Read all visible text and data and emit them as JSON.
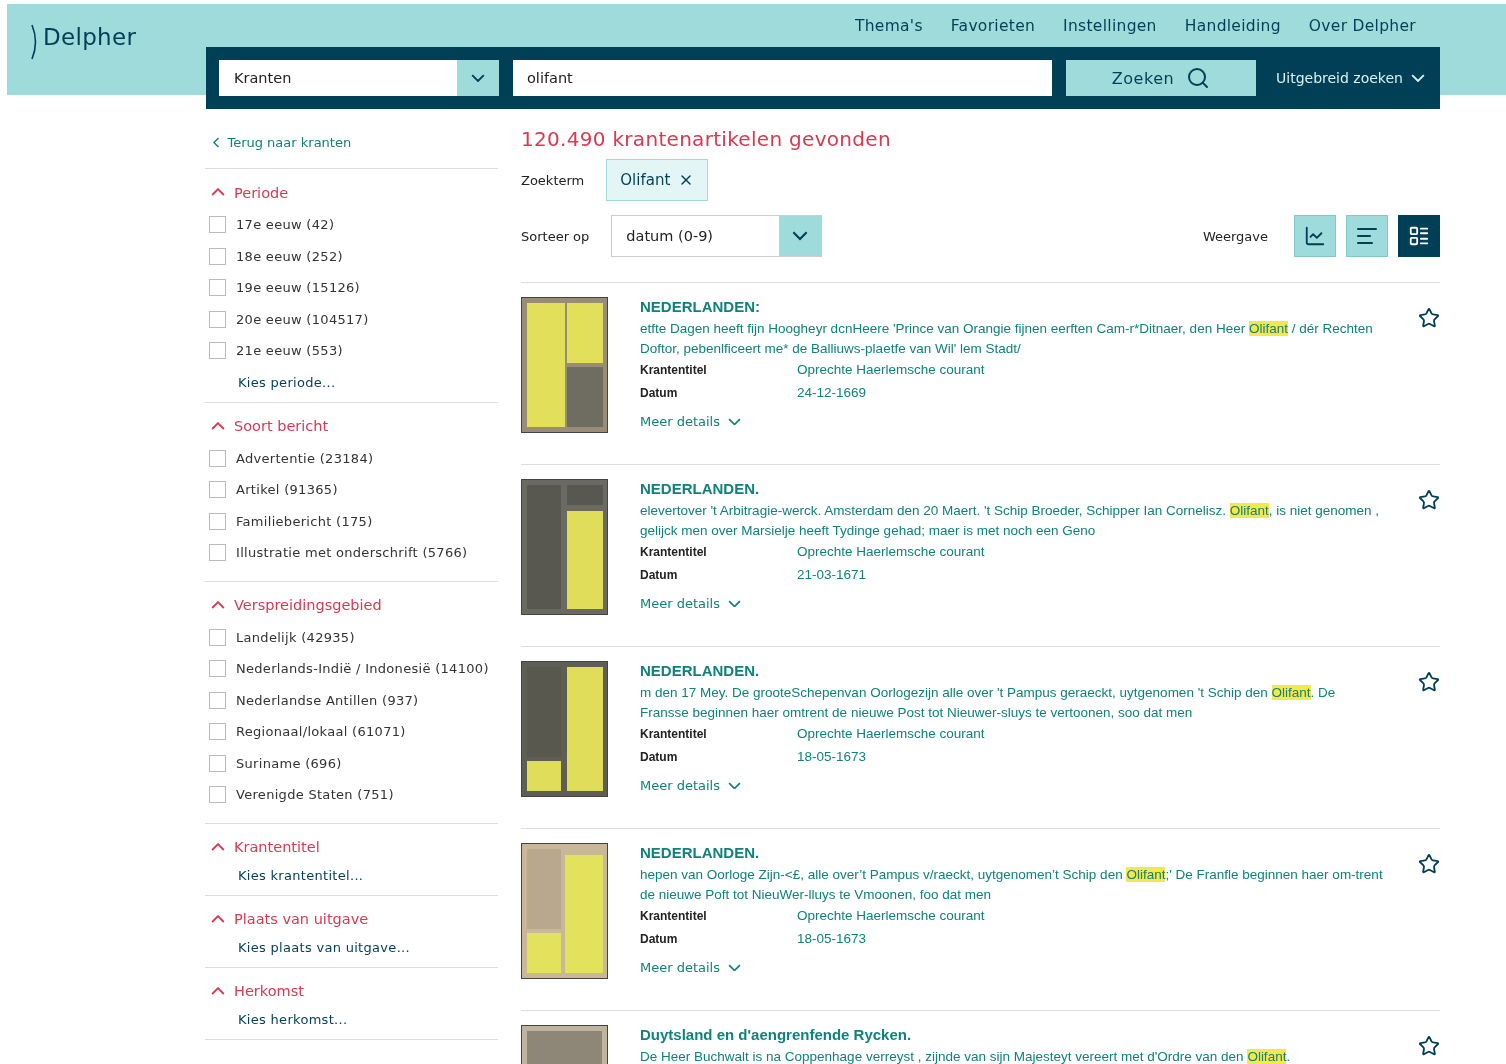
{
  "logo": {
    "text": "Delpher"
  },
  "nav": [
    "Thema's",
    "Favorieten",
    "Instellingen",
    "Handleiding",
    "Over Delpher"
  ],
  "search": {
    "collection": "Kranten",
    "query": "olifant",
    "button": "Zoeken",
    "advanced": "Uitgebreid zoeken"
  },
  "sidebar": {
    "back": "Terug naar kranten",
    "sections": [
      {
        "title": "Periode",
        "expanded": true,
        "items": [
          {
            "label": "17e eeuw (42)",
            "checked": false
          },
          {
            "label": "18e eeuw (252)",
            "checked": false
          },
          {
            "label": "19e eeuw (15126)",
            "checked": false
          },
          {
            "label": "20e eeuw (104517)",
            "checked": false
          },
          {
            "label": "21e eeuw (553)",
            "checked": false
          }
        ],
        "link": "Kies periode..."
      },
      {
        "title": "Soort bericht",
        "expanded": true,
        "items": [
          {
            "label": "Advertentie (23184)",
            "checked": false
          },
          {
            "label": "Artikel (91365)",
            "checked": false
          },
          {
            "label": "Familiebericht (175)",
            "checked": false
          },
          {
            "label": "Illustratie met onderschrift (5766)",
            "checked": false
          }
        ]
      },
      {
        "title": "Verspreidingsgebied",
        "expanded": true,
        "items": [
          {
            "label": "Landelijk (42935)",
            "checked": false
          },
          {
            "label": "Nederlands-Indië / Indonesië (14100)",
            "checked": false
          },
          {
            "label": "Nederlandse Antillen (937)",
            "checked": false
          },
          {
            "label": "Regionaal/lokaal (61071)",
            "checked": false
          },
          {
            "label": "Suriname (696)",
            "checked": false
          },
          {
            "label": "Verenigde Staten (751)",
            "checked": false
          }
        ]
      },
      {
        "title": "Krantentitel",
        "expanded": true,
        "link": "Kies krantentitel..."
      },
      {
        "title": "Plaats van uitgave",
        "expanded": true,
        "link": "Kies plaats van uitgave..."
      },
      {
        "title": "Herkomst",
        "expanded": true,
        "link": "Kies herkomst..."
      }
    ]
  },
  "results_count": "120.490 krantenartikelen gevonden",
  "search_term": {
    "label": "Zoekterm",
    "chip": "Olifant"
  },
  "sort": {
    "label": "Sorteer op",
    "value": "datum (0-9)"
  },
  "view": {
    "label": "Weergave",
    "options": [
      {
        "kind": "chart",
        "selected": false
      },
      {
        "kind": "list",
        "selected": false
      },
      {
        "kind": "detail",
        "selected": true
      }
    ]
  },
  "results": [
    {
      "title": "NEDERLANDEN:",
      "snippet": {
        "before": "etfte Dagen heeft fijn Hoogheyr dcnHeere 'Prince van Orangie fijnen eerften Cam-r*Ditnaer, den Heer ",
        "highlight": "Olifant",
        "after": " / dér Rechten Doftor, pebenlficeert me* de Balliuws-plaetfe van Wil' lem Stadt/"
      },
      "fields": [
        {
          "label": "Krantentitel",
          "value": "Oprechte Haerlemsche courant"
        },
        {
          "label": "Datum",
          "value": "24-12-1669"
        }
      ],
      "more": "Meer details",
      "favorite": false
    },
    {
      "title": "NEDERLANDEN.",
      "snippet": {
        "before": "elevertover 't Arbitragie-werck. Amsterdam den 20 Maert. 't Schip Broeder, Schipper Ian Cornelisz. ",
        "highlight": "Olifant",
        "after": ", is niet genomen , gelijck men over Marsielje heeft Tydinge gehad; maer is met noch een Geno"
      },
      "fields": [
        {
          "label": "Krantentitel",
          "value": "Oprechte Haerlemsche courant"
        },
        {
          "label": "Datum",
          "value": "21-03-1671"
        }
      ],
      "more": "Meer details",
      "favorite": false
    },
    {
      "title": "NEDERLANDEN.",
      "snippet": {
        "before": "m den 17 Mey. De grooteSchepenvan Oorlogezijn alle over 't Pampus geraeckt, uytgenomen 't Schip den ",
        "highlight": "Olifant",
        "after": ". De Fransse beginnen haer omtrent de nieuwe Post tot Nieuwer-sluys te vertoonen, soo dat men"
      },
      "fields": [
        {
          "label": "Krantentitel",
          "value": "Oprechte Haerlemsche courant"
        },
        {
          "label": "Datum",
          "value": "18-05-1673"
        }
      ],
      "more": "Meer details",
      "favorite": false
    },
    {
      "title": "NEDERLANDEN.",
      "snippet": {
        "before": "hepen van Oorloge Zijn-<£, alle over’t Pampus v/raeckt, uytgenomen’t Schip den ",
        "highlight": "Olifant",
        "after": ";' De Franfle beginnen haer om-trent de nieuwe Poft tot NieuWer-lluys te Vmoonen, foo dat men"
      },
      "fields": [
        {
          "label": "Krantentitel",
          "value": "Oprechte Haerlemsche courant"
        },
        {
          "label": "Datum",
          "value": "18-05-1673"
        }
      ],
      "more": "Meer details",
      "favorite": false
    },
    {
      "title": "Duytsland en d'aengrenfende Rycken.",
      "snippet": {
        "before": "De Heer Buchwalt is na Coppenhage verreyst , zijnde van sijn Majesteyt vereert met d'Ordre van den ",
        "highlight": "Olifant",
        "after": "."
      },
      "favorite": false
    }
  ]
}
